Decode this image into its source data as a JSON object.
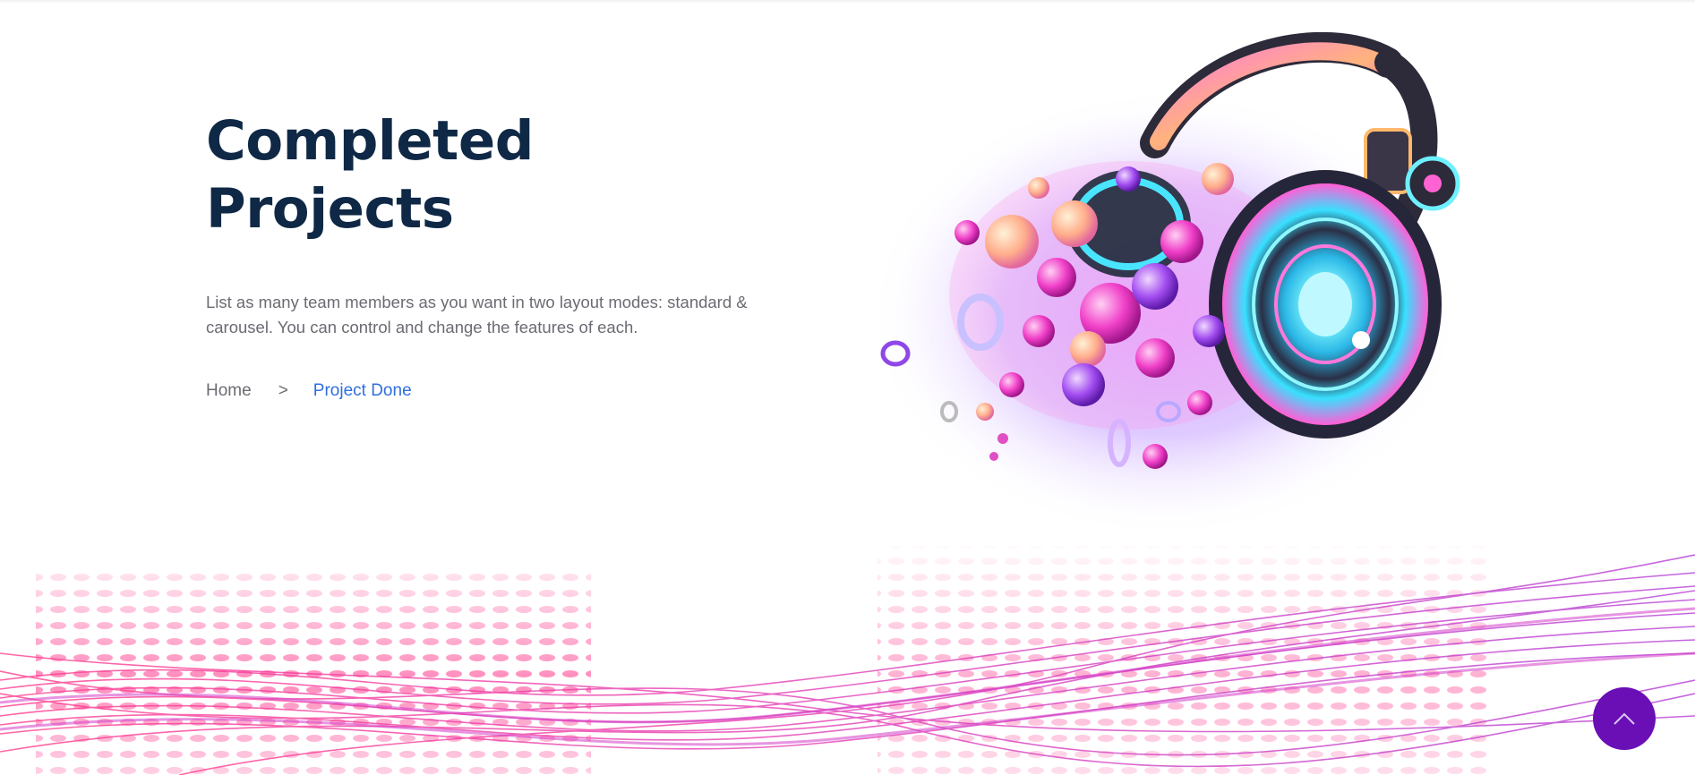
{
  "hero": {
    "title": "Completed Projects",
    "description": "List as many team members as you want in two layout modes: standard & carousel. You can control and change the features of each."
  },
  "breadcrumb": {
    "home_label": "Home",
    "separator": ">",
    "current_label": "Project Done"
  },
  "colors": {
    "title": "#0e2846",
    "body_text": "#6b6b73",
    "link": "#2f6fde",
    "scroll_button": "#6a0fb5",
    "wave_pink": "#ec2a7b",
    "wave_magenta": "#c23fd6"
  },
  "icons": {
    "scroll_top": "chevron-up-icon",
    "hero_art": "headphones-illustration"
  }
}
